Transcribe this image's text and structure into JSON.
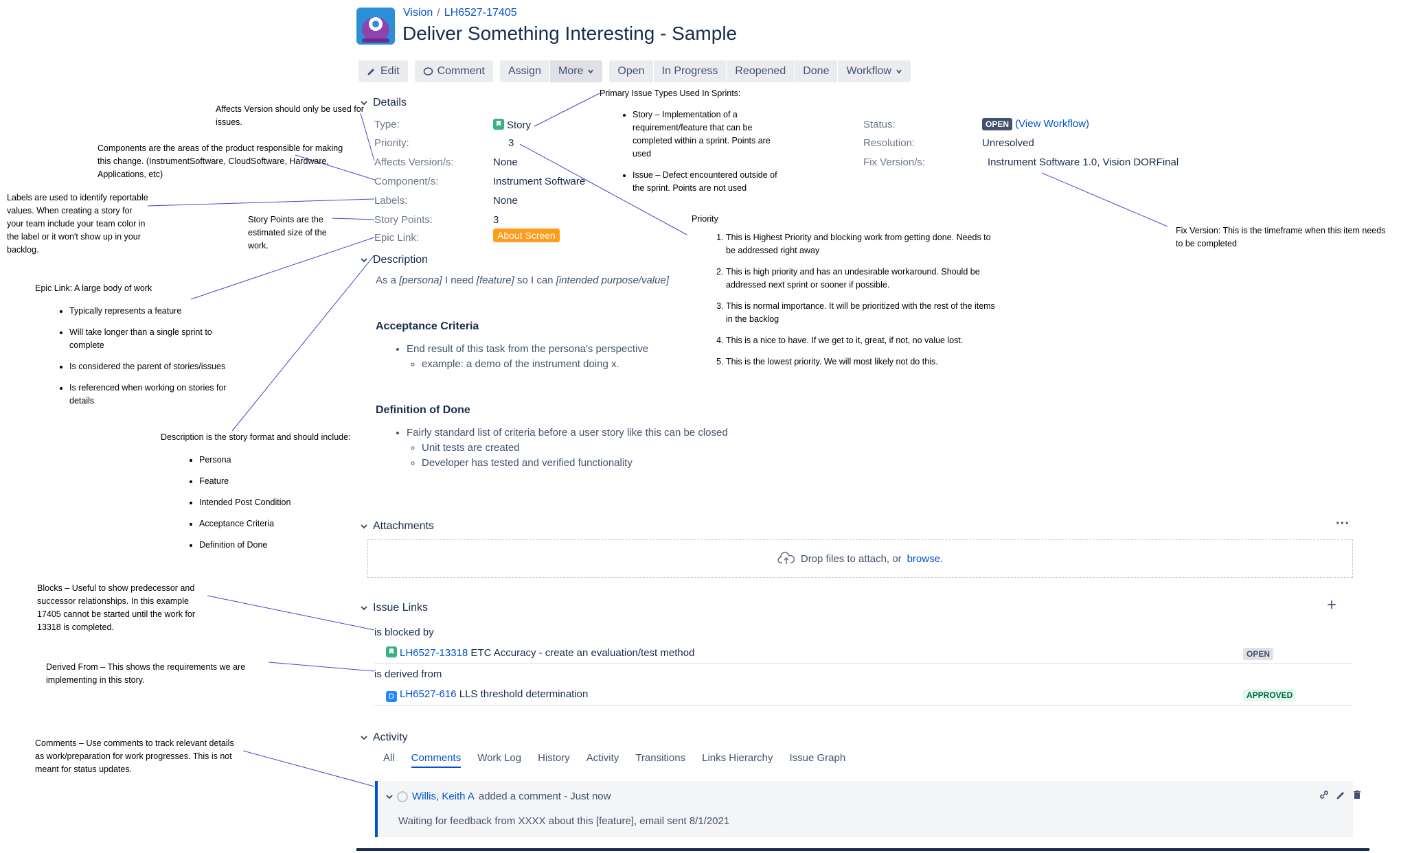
{
  "header": {
    "project": "Vision",
    "issue_key": "LH6527-17405",
    "title": "Deliver Something Interesting - Sample"
  },
  "toolbar": {
    "edit": "Edit",
    "comment": "Comment",
    "assign": "Assign",
    "more": "More",
    "open": "Open",
    "in_progress": "In Progress",
    "reopened": "Reopened",
    "done": "Done",
    "workflow": "Workflow"
  },
  "details": {
    "section": "Details",
    "type_label": "Type:",
    "type_value": "Story",
    "priority_label": "Priority:",
    "priority_value": "3",
    "affects_label": "Affects Version/s:",
    "affects_value": "None",
    "component_label": "Component/s:",
    "component_value": "Instrument Software",
    "labels_label": "Labels:",
    "labels_value": "None",
    "points_label": "Story Points:",
    "points_value": "3",
    "epic_label": "Epic Link:",
    "epic_value": "About Screen",
    "status_label": "Status:",
    "status_value": "OPEN",
    "view_workflow": "(View Workflow)",
    "resolution_label": "Resolution:",
    "resolution_value": "Unresolved",
    "fix_label": "Fix Version/s:",
    "fix_value": "Instrument Software 1.0, Vision DORFinal"
  },
  "description": {
    "section": "Description",
    "line_as": "As a ",
    "persona": "[persona]",
    "line_need": " I need ",
    "feature": "[feature]",
    "line_so": " so I can ",
    "purpose": "[intended purpose/value]",
    "ac_title": "Acceptance Criteria",
    "ac_item": "End result of this task from the persona's perspective",
    "ac_sub": "example: a demo of the instrument doing x.",
    "dod_title": "Definition of Done",
    "dod_item": "Fairly standard list of criteria before a user story like this can be closed",
    "dod_sub1": "Unit tests are created",
    "dod_sub2": "Developer has tested and verified functionality"
  },
  "attachments": {
    "section": "Attachments",
    "drop_text": "Drop files to attach, or ",
    "browse": "browse.",
    "more_icon": "ellipsis-icon"
  },
  "issue_links": {
    "section": "Issue Links",
    "blocked_by": "is blocked by",
    "link1_key": "LH6527-13318",
    "link1_summary": " ETC Accuracy - create an evaluation/test method",
    "link1_status": "OPEN",
    "derived_from": "is derived from",
    "link2_key": "LH6527-616",
    "link2_summary": " LLS threshold determination",
    "link2_status": "APPROVED"
  },
  "activity": {
    "section": "Activity",
    "tabs": [
      "All",
      "Comments",
      "Work Log",
      "History",
      "Activity",
      "Transitions",
      "Links Hierarchy",
      "Issue Graph"
    ],
    "active_tab": "Comments",
    "comment_author": "Willis, Keith A",
    "comment_meta": " added a comment - Just now",
    "comment_body": "Waiting for feedback from XXXX about this [feature], email sent 8/1/2021"
  },
  "annotations": {
    "affects": "Affects Version should only be used for issues.",
    "components": "Components are the areas of the product responsible for making this change.  (InstrumentSoftware, CloudSoftware, Hardware, Applications, etc)",
    "labels": "Labels are used to identify reportable values.  When creating a story for your team include your team color in the label or it won't show up in your backlog.",
    "points": "Story Points are the estimated size of the work.",
    "epic_title": "Epic Link:  A large body of work",
    "epic_items": [
      "Typically represents a feature",
      "Will take longer than a single sprint to complete",
      "Is considered the parent of stories/issues",
      "Is referenced when working on stories for details"
    ],
    "desc_title": "Description is the story format and should include:",
    "desc_items": [
      "Persona",
      "Feature",
      "Intended Post Condition",
      "Acceptance Criteria",
      "Definition of Done"
    ],
    "types_title": "Primary Issue Types Used In Sprints:",
    "types_items": [
      "Story – Implementation of a requirement/feature that can be completed within a sprint.  Points are used",
      "Issue – Defect encountered outside of the sprint.  Points are not used"
    ],
    "priority_title": "Priority",
    "priority_items": [
      "This is Highest Priority and blocking work from getting done.  Needs to be addressed right away",
      "This is high priority and has an undesirable workaround.  Should be addressed next sprint or sooner if possible.",
      "This is normal importance.  It will be prioritized with the rest of the items in the backlog",
      "This is a nice to have.  If we get to it, great, if not, no value lost.",
      "This is the lowest priority.  We will most likely not do this."
    ],
    "fix": "Fix Version:  This is the timeframe when this item needs to be completed",
    "blocks": "Blocks – Useful to show predecessor and successor relationships.  In this example 17405 cannot be started until the work for 13318 is completed.",
    "derived": "Derived From – This shows the requirements we are implementing in this story.",
    "comments": "Comments – Use comments to track relevant details as work/preparation for work progresses.  This is not meant for status updates."
  }
}
